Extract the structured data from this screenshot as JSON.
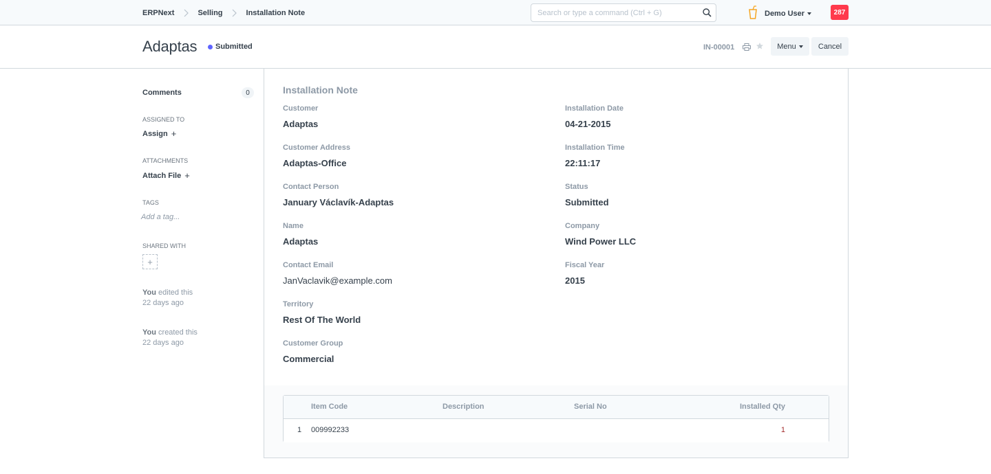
{
  "navbar": {
    "breadcrumbs": [
      "ERPNext",
      "Selling",
      "Installation Note"
    ],
    "search_placeholder": "Search or type a command (Ctrl + G)",
    "user_name": "Demo User",
    "notification_count": "287"
  },
  "page": {
    "title": "Adaptas",
    "status": "Submitted",
    "doc_name": "IN-00001",
    "menu_label": "Menu",
    "cancel_label": "Cancel"
  },
  "sidebar": {
    "comments_label": "Comments",
    "comments_count": "0",
    "assigned_to_heading": "ASSIGNED TO",
    "assign_label": "Assign",
    "attachments_heading": "ATTACHMENTS",
    "attach_label": "Attach File",
    "tags_heading": "TAGS",
    "tag_placeholder": "Add a tag...",
    "shared_with_heading": "SHARED WITH",
    "timeline": [
      {
        "actor": "You",
        "action": " edited this",
        "when": "22 days ago"
      },
      {
        "actor": "You",
        "action": " created this",
        "when": "22 days ago"
      }
    ]
  },
  "form": {
    "section_title": "Installation Note",
    "left_fields": [
      {
        "label": "Customer",
        "value": "Adaptas"
      },
      {
        "label": "Customer Address",
        "value": "Adaptas-Office"
      },
      {
        "label": "Contact Person",
        "value": "January Václavík-Adaptas"
      },
      {
        "label": "Name",
        "value": "Adaptas"
      },
      {
        "label": "Contact Email",
        "value": "JanVaclavik@example.com"
      },
      {
        "label": "Territory",
        "value": "Rest Of The World"
      },
      {
        "label": "Customer Group",
        "value": "Commercial"
      }
    ],
    "right_fields": [
      {
        "label": "Installation Date",
        "value": "04-21-2015"
      },
      {
        "label": "Installation Time",
        "value": "22:11:17"
      },
      {
        "label": "Status",
        "value": "Submitted"
      },
      {
        "label": "Company",
        "value": "Wind Power LLC"
      },
      {
        "label": "Fiscal Year",
        "value": "2015"
      }
    ]
  },
  "items_table": {
    "columns": [
      "Item Code",
      "Description",
      "Serial No",
      "Installed Qty"
    ],
    "rows": [
      {
        "idx": "1",
        "item_code": "009992233",
        "description": "",
        "serial_no": "",
        "installed_qty": "1"
      }
    ]
  },
  "colors": {
    "accent": "#5e64ff",
    "notification": "#ff3a4c",
    "muted_text": "#8d99a6",
    "text": "#36414c"
  }
}
